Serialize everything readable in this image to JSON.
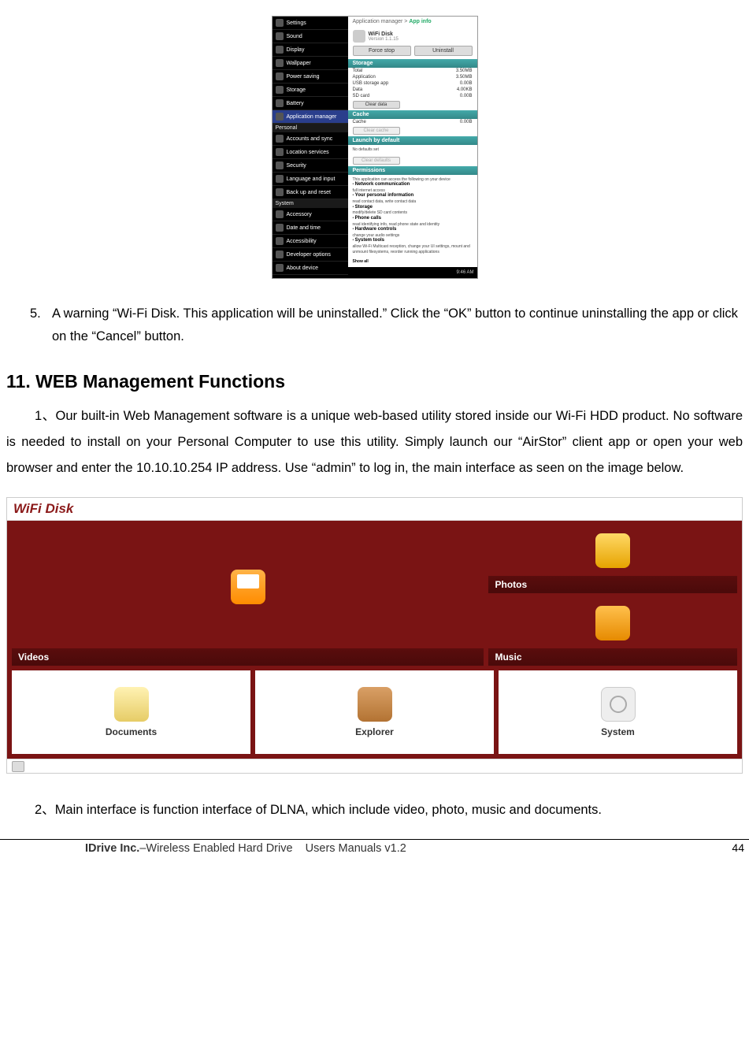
{
  "android": {
    "left_sections": {
      "top_row": "Settings",
      "items1": [
        "Sound",
        "Display",
        "Wallpaper",
        "Power saving",
        "Storage",
        "Battery",
        "Application manager"
      ],
      "group2": "Personal",
      "items2": [
        "Accounts and sync",
        "Location services",
        "Security",
        "Language and input",
        "Back up and reset"
      ],
      "group3": "System",
      "items3": [
        "Accessory",
        "Date and time",
        "Accessibility",
        "Developer options",
        "About device"
      ]
    },
    "crumb_a": "Application manager",
    "crumb_b": "App info",
    "app_name": "WiFi Disk",
    "app_ver": "Version 1.1.15",
    "btn_force": "Force stop",
    "btn_uninstall": "Uninstall",
    "sec_storage": "Storage",
    "storage_rows": [
      [
        "Total",
        "3.50MB"
      ],
      [
        "Application",
        "3.50MB"
      ],
      [
        "USB storage app",
        "0.00B"
      ],
      [
        "Data",
        "4.00KB"
      ],
      [
        "SD card",
        "0.00B"
      ]
    ],
    "btn_cleardata": "Clear data",
    "sec_cache": "Cache",
    "cache_row": [
      "Cache",
      "0.00B"
    ],
    "btn_clearcache": "Clear cache",
    "sec_launch": "Launch by default",
    "launch_text": "No defaults set",
    "btn_cleardef": "Clear defaults",
    "sec_perm": "Permissions",
    "perm_intro": "This application can access the following on your device",
    "perms": [
      [
        "Network communication",
        "full internet access"
      ],
      [
        "Your personal information",
        "read contact data, write contact data"
      ],
      [
        "Storage",
        "modify/delete SD card contents"
      ],
      [
        "Phone calls",
        "read identifying info, read phone state and identity"
      ],
      [
        "Hardware controls",
        "change your audio settings"
      ],
      [
        "System tools",
        "allow Wi-Fi Multicast reception, change your UI settings, mount and unmount filesystems, reorder running applications"
      ]
    ],
    "show_all": "Show all",
    "clock": "9:46 AM"
  },
  "step5": {
    "num": "5.",
    "text": "A warning “Wi-Fi Disk. This application will be uninstalled.”    Click the “OK” button to continue uninstalling the app or click on the “Cancel” button."
  },
  "h2": "11. WEB Management Functions",
  "para1": {
    "idx": "1、",
    "text": "Our built-in Web Management software is a unique web-based utility stored inside our Wi-Fi HDD product.   No software is needed to install on your Personal Computer to use this utility.   Simply launch our “AirStor” client app or open your web browser and enter the 10.10.10.254 IP address.    Use “admin” to log in, the main interface as seen on the image below."
  },
  "wifidisk": {
    "title": "WiFi Disk",
    "videos": "Videos",
    "photos": "Photos",
    "music": "Music",
    "documents": "Documents",
    "explorer": "Explorer",
    "system": "System"
  },
  "para2": {
    "idx": "2、",
    "text": "Main interface is function interface of DLNA, which include video, photo, music and documents."
  },
  "footer": {
    "company": "IDrive Inc.",
    "prod": "–Wireless Enabled Hard Drive",
    "man": "Users Manuals v1.2",
    "page": "44"
  }
}
